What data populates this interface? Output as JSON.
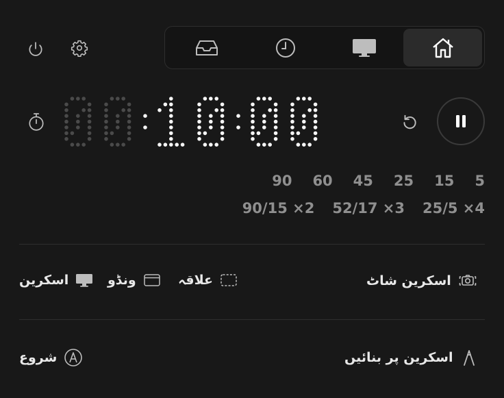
{
  "header": {
    "power_icon": "power-icon",
    "settings_icon": "gear-icon",
    "tabs": [
      {
        "icon": "inbox-tray-icon",
        "active": false
      },
      {
        "icon": "clock-icon",
        "active": false
      },
      {
        "icon": "monitor-icon",
        "active": false
      },
      {
        "icon": "home-icon",
        "active": true
      }
    ]
  },
  "timer": {
    "display": "00:10:00",
    "icon": "stopwatch-icon",
    "reset_icon": "reset-arrow-icon",
    "pause_icon": "pause-icon",
    "presets": [
      "90",
      "60",
      "45",
      "25",
      "15",
      "5"
    ],
    "cycles": [
      "90/15 ×2",
      "52/17 ×3",
      "25/5 ×4"
    ]
  },
  "capture": {
    "screenshot_label": "اسکرین شاٹ",
    "area_label": "علاقہ",
    "window_label": "ونڈو",
    "screen_label": "اسکرین"
  },
  "recording": {
    "record_label": "اسکرین پر بنائیں",
    "start_label": "شروع"
  },
  "colors": {
    "background": "#181818",
    "text": "#e8e8e8",
    "muted": "#8f8f8f",
    "active_tab": "#2b2b2b"
  }
}
